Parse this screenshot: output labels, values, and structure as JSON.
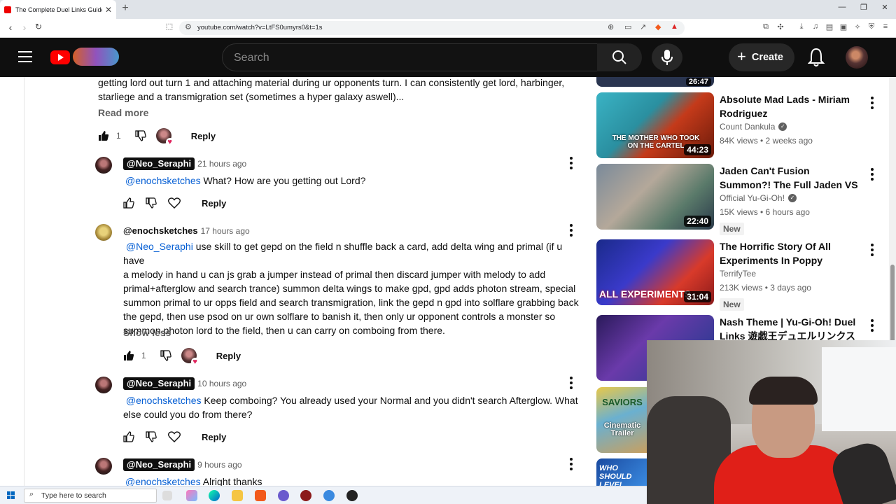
{
  "browser": {
    "tab_title": "The Complete Duel Links Guide",
    "tab_close": "✕",
    "new_tab": "+",
    "url": "youtube.com/watch?v=LtFS0umyrs0&t=1s",
    "win_min": "—",
    "win_max": "❐",
    "win_close": "✕"
  },
  "masthead": {
    "search_placeholder": "Search",
    "create_label": "Create",
    "create_plus": "+"
  },
  "comments": {
    "top_reply": {
      "line1": "getting lord out turn 1 and attaching material during ur opponents turn. I can consistently get lord, harbinger,",
      "line2": "starliege and a transmigration set (sometimes a hyper galaxy aswell)...",
      "read_more": "Read more",
      "likes": "1",
      "reply": "Reply"
    },
    "replies": [
      {
        "author": "@Neo_Seraphi",
        "time": "21 hours ago",
        "mention": "@enochsketches",
        "text": " What? How are you getting out Lord?",
        "reply": "Reply"
      },
      {
        "author": "@enochsketches",
        "time": "17 hours ago",
        "mention": "@Neo_Seraphi",
        "lines": [
          " use skill to get gepd on the field n shuffle back a card, add delta wing and primal (if u have",
          "a melody in hand u can js grab a jumper instead of primal then discard jumper with melody to add",
          "primal+afterglow and search trance) summon delta wings to make gpd, gpd adds photon stream, special",
          "summon primal to ur opps field and search transmigration, link the gepd n gpd into solflare grabbing back",
          "the gepd, then use psod on ur own solflare to banish it, then only ur opponent controls a monster so",
          "summon photon lord to the field, then u can carry on comboing from there."
        ],
        "show_less": "Show less",
        "likes": "1",
        "reply": "Reply"
      },
      {
        "author": "@Neo_Seraphi",
        "time": "10 hours ago",
        "mention": "@enochsketches",
        "line1": " Keep comboing? You already used your Normal and you didn't search Afterglow. What",
        "line2": "else could you do from there?",
        "reply": "Reply"
      },
      {
        "author": "@Neo_Seraphi",
        "time": "9 hours ago",
        "mention": "@enochsketches",
        "text": " Alright thanks"
      }
    ]
  },
  "recommendations": [
    {
      "title": "Absolute Mad Lads - Miriam Rodriguez",
      "channel": "Count Dankula",
      "verified": true,
      "meta": "84K views • 2 weeks ago",
      "duration": "44:23",
      "thumb_text": "THE MOTHER WHO TOOK ON THE CARTEL"
    },
    {
      "title": "Jaden Can't Fusion Summon?! The Full Jaden VS Bastion Due...",
      "channel": "Official Yu-Gi-Oh!",
      "verified": true,
      "meta": "15K views • 6 hours ago",
      "duration": "22:40",
      "badge": "New"
    },
    {
      "title": "The Horrific Story Of All Experiments In Poppy Playtim...",
      "channel": "TerrifyTee",
      "verified": false,
      "meta": "213K views • 3 days ago",
      "duration": "31:04",
      "badge": "New",
      "thumb_text": "ALL EXPERIMENTS"
    },
    {
      "title": "Nash Theme | Yu-Gi-Oh! Duel Links 遊戯王デュエルリンクス"
    }
  ],
  "partial_thumbs": {
    "top_duration": "26:47",
    "saviors_title": "SAVIORS",
    "saviors_sub": "Cinematic Trailer",
    "level_text": "WHO SHOULD LEVEL"
  },
  "taskbar": {
    "search_placeholder": "Type here to search"
  },
  "colors": {
    "masthead": "#0f0f0f",
    "mention": "#065fd4",
    "youtube_red": "#ff0000"
  }
}
